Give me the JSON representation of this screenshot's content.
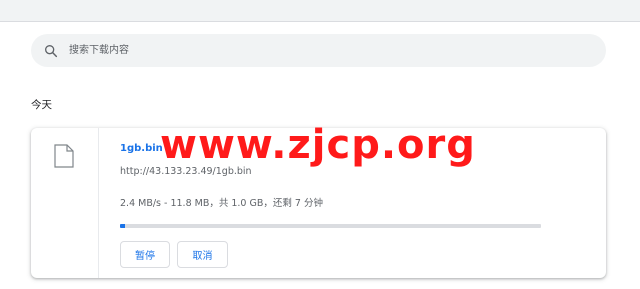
{
  "search": {
    "placeholder": "搜索下载内容"
  },
  "section": {
    "label": "今天"
  },
  "download": {
    "file_name": "1gb.bin",
    "url": "http://43.133.23.49/1gb.bin",
    "status": "2.4 MB/s - 11.8 MB，共 1.0 GB，还剩 7 分钟",
    "progress_fraction": 0.0115,
    "icon": "file-icon",
    "pause_label": "暂停",
    "cancel_label": "取消"
  },
  "watermark": {
    "text": "www.zjcp.org"
  },
  "colors": {
    "accent": "#1a73e8",
    "watermark": "#ff1a1a"
  }
}
